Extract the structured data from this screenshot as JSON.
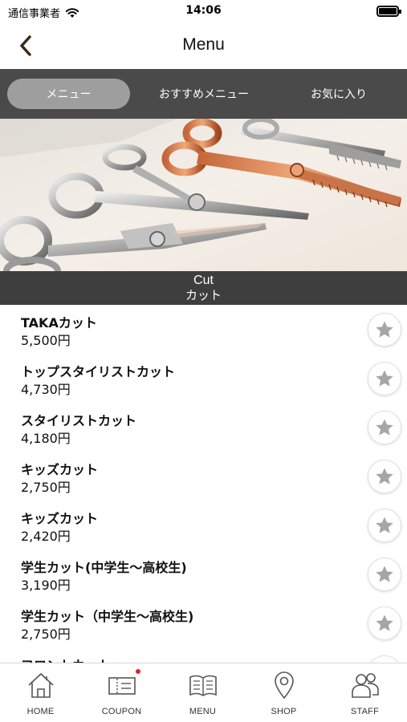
{
  "status_bar": {
    "carrier": "通信事業者",
    "time": "14:06"
  },
  "nav": {
    "title": "Menu"
  },
  "tabs": [
    {
      "label": "メニュー",
      "active": true
    },
    {
      "label": "おすすめメニュー",
      "active": false
    },
    {
      "label": "お気に入り",
      "active": false
    }
  ],
  "section": {
    "title_en": "Cut",
    "title_jp": "カット"
  },
  "menu_items": [
    {
      "name": "TAKAカット",
      "price": "5,500円"
    },
    {
      "name": "トップスタイリストカット",
      "price": "4,730円"
    },
    {
      "name": "スタイリストカット",
      "price": "4,180円"
    },
    {
      "name": "キッズカット",
      "price": "2,750円"
    },
    {
      "name": "キッズカット",
      "price": "2,420円"
    },
    {
      "name": "学生カット(中学生～高校生)",
      "price": "3,190円"
    },
    {
      "name": "学生カット（中学生～高校生)",
      "price": "2,750円"
    },
    {
      "name": "フロントカット",
      "price": ""
    }
  ],
  "tab_bar": [
    {
      "label": "HOME",
      "icon": "home-icon"
    },
    {
      "label": "COUPON",
      "icon": "coupon-icon",
      "badge": true
    },
    {
      "label": "MENU",
      "icon": "menu-book-icon"
    },
    {
      "label": "SHOP",
      "icon": "map-pin-icon"
    },
    {
      "label": "STAFF",
      "icon": "staff-icon"
    }
  ],
  "colors": {
    "tab_bg": "#4a4a4a",
    "tab_active": "#9e9e9e",
    "section_bg": "#3e3e3e",
    "star": "#a6a6a6",
    "badge": "#e8212a"
  }
}
